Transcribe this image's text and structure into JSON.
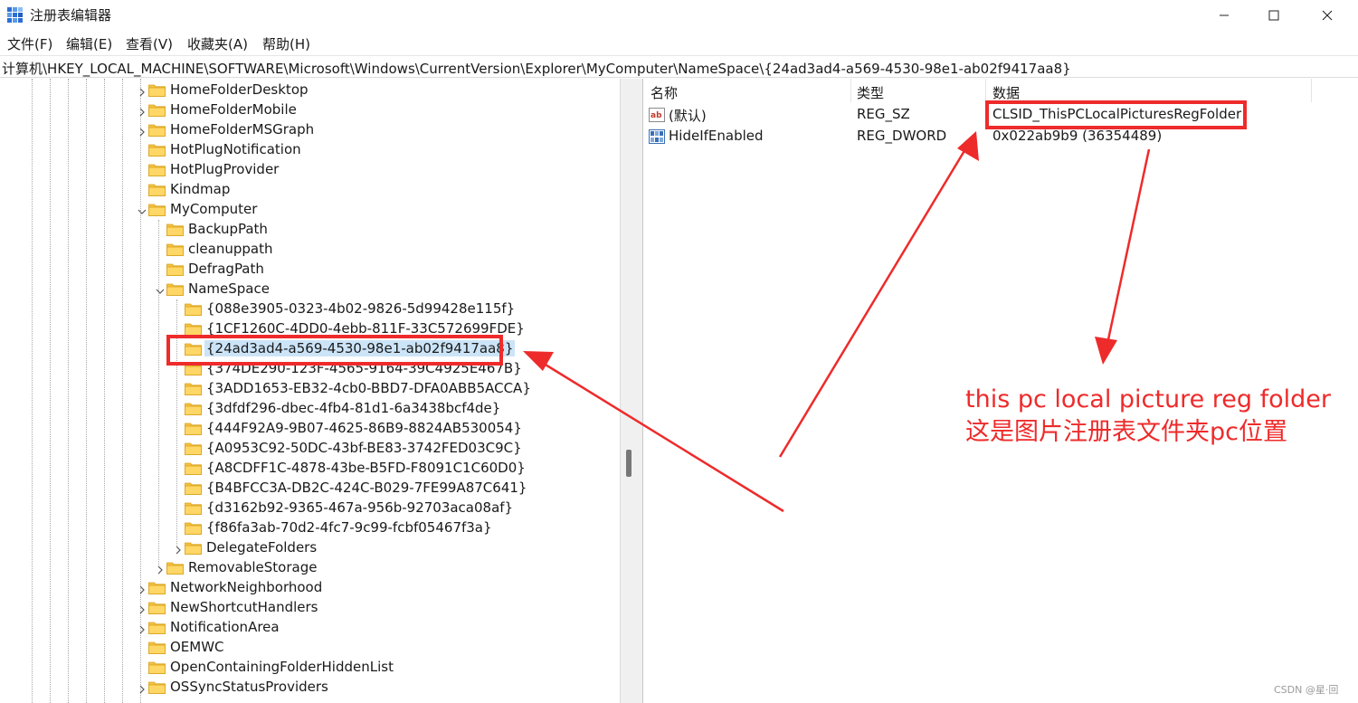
{
  "window": {
    "title": "注册表编辑器",
    "accent": "#2b6fd6"
  },
  "menu": {
    "file": "文件(F)",
    "edit": "编辑(E)",
    "view": "查看(V)",
    "favorites": "收藏夹(A)",
    "help": "帮助(H)"
  },
  "address": "计算机\\HKEY_LOCAL_MACHINE\\SOFTWARE\\Microsoft\\Windows\\CurrentVersion\\Explorer\\MyComputer\\NameSpace\\{24ad3ad4-a569-4530-98e1-ab02f9417aa8}",
  "tree": {
    "items": [
      {
        "label": "HomeFolderDesktop",
        "depth": 0,
        "state": "collapsed"
      },
      {
        "label": "HomeFolderMobile",
        "depth": 0,
        "state": "collapsed"
      },
      {
        "label": "HomeFolderMSGraph",
        "depth": 0,
        "state": "collapsed"
      },
      {
        "label": "HotPlugNotification",
        "depth": 0,
        "state": "leaf"
      },
      {
        "label": "HotPlugProvider",
        "depth": 0,
        "state": "leaf"
      },
      {
        "label": "Kindmap",
        "depth": 0,
        "state": "leaf"
      },
      {
        "label": "MyComputer",
        "depth": 0,
        "state": "expanded"
      },
      {
        "label": "BackupPath",
        "depth": 1,
        "state": "leaf"
      },
      {
        "label": "cleanuppath",
        "depth": 1,
        "state": "leaf"
      },
      {
        "label": "DefragPath",
        "depth": 1,
        "state": "leaf"
      },
      {
        "label": "NameSpace",
        "depth": 1,
        "state": "expanded"
      },
      {
        "label": "{088e3905-0323-4b02-9826-5d99428e115f}",
        "depth": 2,
        "state": "leaf"
      },
      {
        "label": "{1CF1260C-4DD0-4ebb-811F-33C572699FDE}",
        "depth": 2,
        "state": "leaf"
      },
      {
        "label": "{24ad3ad4-a569-4530-98e1-ab02f9417aa8}",
        "depth": 2,
        "state": "leaf",
        "selected": true
      },
      {
        "label": "{374DE290-123F-4565-9164-39C4925E467B}",
        "depth": 2,
        "state": "leaf"
      },
      {
        "label": "{3ADD1653-EB32-4cb0-BBD7-DFA0ABB5ACCA}",
        "depth": 2,
        "state": "leaf"
      },
      {
        "label": "{3dfdf296-dbec-4fb4-81d1-6a3438bcf4de}",
        "depth": 2,
        "state": "leaf"
      },
      {
        "label": "{444F92A9-9B07-4625-86B9-8824AB530054}",
        "depth": 2,
        "state": "leaf"
      },
      {
        "label": "{A0953C92-50DC-43bf-BE83-3742FED03C9C}",
        "depth": 2,
        "state": "leaf"
      },
      {
        "label": "{A8CDFF1C-4878-43be-B5FD-F8091C1C60D0}",
        "depth": 2,
        "state": "leaf"
      },
      {
        "label": "{B4BFCC3A-DB2C-424C-B029-7FE99A87C641}",
        "depth": 2,
        "state": "leaf"
      },
      {
        "label": "{d3162b92-9365-467a-956b-92703aca08af}",
        "depth": 2,
        "state": "leaf"
      },
      {
        "label": "{f86fa3ab-70d2-4fc7-9c99-fcbf05467f3a}",
        "depth": 2,
        "state": "leaf"
      },
      {
        "label": "DelegateFolders",
        "depth": 2,
        "state": "collapsed"
      },
      {
        "label": "RemovableStorage",
        "depth": 1,
        "state": "collapsed"
      },
      {
        "label": "NetworkNeighborhood",
        "depth": 0,
        "state": "collapsed"
      },
      {
        "label": "NewShortcutHandlers",
        "depth": 0,
        "state": "collapsed"
      },
      {
        "label": "NotificationArea",
        "depth": 0,
        "state": "collapsed"
      },
      {
        "label": "OEMWC",
        "depth": 0,
        "state": "leaf"
      },
      {
        "label": "OpenContainingFolderHiddenList",
        "depth": 0,
        "state": "leaf"
      },
      {
        "label": "OSSyncStatusProviders",
        "depth": 0,
        "state": "collapsed"
      }
    ]
  },
  "values": {
    "headers": {
      "name": "名称",
      "type": "类型",
      "data": "数据"
    },
    "rows": [
      {
        "icon": "string-value-icon",
        "name": "(默认)",
        "type": "REG_SZ",
        "data": "CLSID_ThisPCLocalPicturesRegFolder"
      },
      {
        "icon": "dword-value-icon",
        "name": "HideIfEnabled",
        "type": "REG_DWORD",
        "data": "0x022ab9b9 (36354489)"
      }
    ]
  },
  "annotation": {
    "line1": "this pc local picture reg folder",
    "line2": "这是图片注册表文件夹pc位置",
    "color": "#ee2b2b"
  },
  "watermark": "CSDN @星·回"
}
